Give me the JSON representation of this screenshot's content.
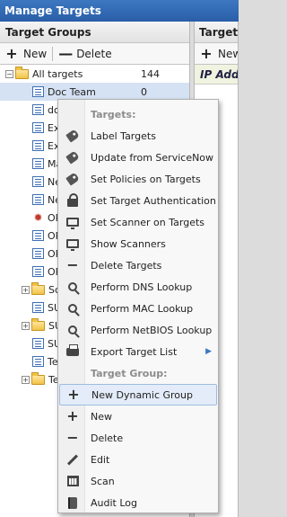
{
  "window": {
    "title": "Manage Targets"
  },
  "left_panel": {
    "header": "Target Groups",
    "toolbar": {
      "new_label": "New",
      "delete_label": "Delete",
      "new_symbol": "+",
      "delete_symbol": "—"
    },
    "tree": [
      {
        "label": "All targets",
        "count": "144",
        "kind": "folder",
        "expander": "−",
        "selected": false
      },
      {
        "label": "Doc Team",
        "count": "0",
        "kind": "list",
        "selected": true
      },
      {
        "label": "do",
        "kind": "list"
      },
      {
        "label": "Ex",
        "kind": "list"
      },
      {
        "label": "Ex",
        "kind": "list"
      },
      {
        "label": "Ma",
        "kind": "list"
      },
      {
        "label": "Ne",
        "kind": "list"
      },
      {
        "label": "Ne",
        "kind": "list"
      },
      {
        "label": "OR",
        "kind": "star"
      },
      {
        "label": "OR",
        "kind": "list"
      },
      {
        "label": "OR",
        "kind": "list"
      },
      {
        "label": "OR",
        "kind": "list"
      },
      {
        "label": "Sc",
        "kind": "folder",
        "expander": "+"
      },
      {
        "label": "SU",
        "kind": "list"
      },
      {
        "label": "SU",
        "kind": "folder",
        "expander": "+"
      },
      {
        "label": "SU",
        "kind": "list"
      },
      {
        "label": "Te",
        "kind": "list"
      },
      {
        "label": "Te",
        "kind": "folder",
        "expander": "+"
      }
    ]
  },
  "right_panel": {
    "header": "Targets",
    "toolbar": {
      "new_label": "New",
      "new_symbol": "+"
    },
    "column_header": "IP Addre"
  },
  "context_menu": {
    "items": [
      {
        "label": "Targets:",
        "section": true
      },
      {
        "label": "Label Targets",
        "icon": "tag-icon"
      },
      {
        "label": "Update from ServiceNow",
        "icon": "tag-icon"
      },
      {
        "label": "Set Policies on Targets",
        "icon": "tag-icon"
      },
      {
        "label": "Set Target Authentication",
        "icon": "lock-icon"
      },
      {
        "label": "Set Scanner on Targets",
        "icon": "monitor-icon"
      },
      {
        "label": "Show Scanners",
        "icon": "monitor-icon"
      },
      {
        "label": "Delete Targets",
        "icon": "minus-icon"
      },
      {
        "label": "Perform DNS Lookup",
        "icon": "search-icon"
      },
      {
        "label": "Perform MAC Lookup",
        "icon": "search-icon"
      },
      {
        "label": "Perform NetBIOS Lookup",
        "icon": "search-icon"
      },
      {
        "label": "Export Target List",
        "icon": "printer-icon",
        "submenu": true
      },
      {
        "label": "Target Group:",
        "section": true
      },
      {
        "label": "New Dynamic Group",
        "icon": "plus-icon",
        "hover": true
      },
      {
        "label": "New",
        "icon": "plus-icon"
      },
      {
        "label": "Delete",
        "icon": "minus-icon"
      },
      {
        "label": "Edit",
        "icon": "pencil-icon"
      },
      {
        "label": "Scan",
        "icon": "calendar-icon"
      },
      {
        "label": "Audit Log",
        "icon": "book-icon"
      }
    ]
  }
}
